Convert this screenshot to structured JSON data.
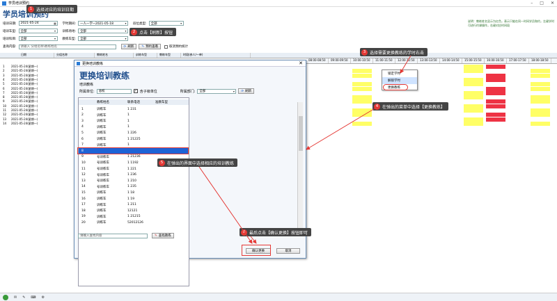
{
  "window": {
    "title": "学员培训预约"
  },
  "page_title": "学员培训预约",
  "tip": "说明：教练姓名显示为红色，表示只能在同一时间学员和约，左键学时可进行约课操作，右键对应时间段",
  "filters": {
    "date_label": "培训日期:",
    "date_value": "2021-05-24",
    "period_label": "学时期间:",
    "period_value": "一人一学~2021-05-18",
    "section_label": "段位类型:",
    "section_value": "全部",
    "car_label": "培训车型:",
    "car_value": "全部",
    "site_label": "训练场地:",
    "site_value": "全部",
    "subject_label": "培训科目:",
    "subject_value": "全部",
    "type_label": "教练车型:",
    "type_value": "全部",
    "query_label": "查询内容:",
    "query_placeholder": "请输入 分组名称\\教练姓名",
    "refresh_btn": "刷新",
    "book_btn": "预约查看",
    "cancel_check": "取消预约统计"
  },
  "grid": {
    "headers": [
      "日期",
      "分组名称",
      "教练姓名",
      "训练车型",
      "教练车型",
      "时段(参人/一单)"
    ],
    "time_headers": [
      "08:00-08:50",
      "09:00-09:50",
      "10:00-10:50",
      "11:00-11:50",
      "12:00-12:50",
      "13:00-13:50",
      "14:00-14:50",
      "15:00-15:50",
      "16:00-16:50",
      "17:00-17:50",
      "18:00-18:50"
    ],
    "rows": [
      {
        "n": "1",
        "date": "2021-05-24(星期一)"
      },
      {
        "n": "2",
        "date": "2021-05-24(星期一)"
      },
      {
        "n": "3",
        "date": "2021-05-24(星期一)"
      },
      {
        "n": "4",
        "date": "2021-05-24(星期一)"
      },
      {
        "n": "5",
        "date": "2021-05-24(星期一)"
      },
      {
        "n": "6",
        "date": "2021-05-24(星期一)"
      },
      {
        "n": "7",
        "date": "2021-05-24(星期一)"
      },
      {
        "n": "8",
        "date": "2021-05-24(星期一)"
      },
      {
        "n": "9",
        "date": "2021-05-24(星期一)"
      },
      {
        "n": "10",
        "date": "2021-05-24(星期一)"
      },
      {
        "n": "11",
        "date": "2021-05-24(星期一)"
      },
      {
        "n": "12",
        "date": "2021-05-24(星期一)"
      },
      {
        "n": "13",
        "date": "2021-05-24(星期一)"
      },
      {
        "n": "14",
        "date": "2021-05-24(星期一)"
      }
    ]
  },
  "context_menu": [
    "锁定学时",
    "解锁学时",
    "更换教练"
  ],
  "dialog": {
    "title": "更换培训教练",
    "heading": "更换培训教练",
    "section": "培训教练",
    "unit_label": "所属单位:",
    "unit_value": "总校",
    "include_sub": "含子级单位",
    "dept_label": "所属部门:",
    "dept_value": "全部",
    "refresh_btn": "刷新",
    "table_headers": [
      "教练姓名",
      "联系电话",
      "准教车型"
    ],
    "rows": [
      {
        "n": "1",
        "name": "训练车",
        "phone": "1 231"
      },
      {
        "n": "2",
        "name": "训练车",
        "phone": "1 "
      },
      {
        "n": "3",
        "name": "训练车",
        "phone": "1 "
      },
      {
        "n": "4",
        "name": "训练车",
        "phone": "1 "
      },
      {
        "n": "5",
        "name": "训练车",
        "phone": "1 226"
      },
      {
        "n": "6",
        "name": "训练车",
        "phone": "1 21225"
      },
      {
        "n": "7",
        "name": "训练车",
        "phone": "1 "
      },
      {
        "n": "8",
        "name": "",
        "phone": ""
      },
      {
        "n": "9",
        "name": "号训练车",
        "phone": "1 21236"
      },
      {
        "n": "10",
        "name": "号训练车",
        "phone": "1 1192"
      },
      {
        "n": "11",
        "name": "号训练车",
        "phone": "1 221"
      },
      {
        "n": "12",
        "name": "号训练车",
        "phone": "1 236"
      },
      {
        "n": "13",
        "name": "号训练车",
        "phone": "1 210"
      },
      {
        "n": "14",
        "name": "号训练车",
        "phone": "1 235"
      },
      {
        "n": "15",
        "name": "训练车",
        "phone": "1 18"
      },
      {
        "n": "16",
        "name": "训练车",
        "phone": "1 19"
      },
      {
        "n": "17",
        "name": "训练车",
        "phone": "1 211"
      },
      {
        "n": "18",
        "name": "训练车",
        "phone": "12121"
      },
      {
        "n": "19",
        "name": "训练车",
        "phone": "1 21215"
      },
      {
        "n": "20",
        "name": "训练车",
        "phone": "52012126"
      }
    ],
    "search_placeholder": "请输入查找内容",
    "search_btn": "查找教练",
    "confirm_btn": "确认更换",
    "cancel_btn": "取消"
  },
  "callouts": [
    {
      "n": "1",
      "text": "选择对应的培训日期"
    },
    {
      "n": "2",
      "text": "点击【刷新】按钮"
    },
    {
      "n": "3",
      "text": "选择需要更换教练的学时右击"
    },
    {
      "n": "4",
      "text": "在弹出的菜单中选择【更换教练】"
    },
    {
      "n": "5",
      "text": "在弹出的界面中选择相应的培训教练"
    },
    {
      "n": "6",
      "text": "最后点击【确认更换】按钮即可"
    }
  ],
  "colors": {
    "accent": "#1f4e8c",
    "callout_num": "#e53935",
    "highlight": "#1e63d6"
  }
}
